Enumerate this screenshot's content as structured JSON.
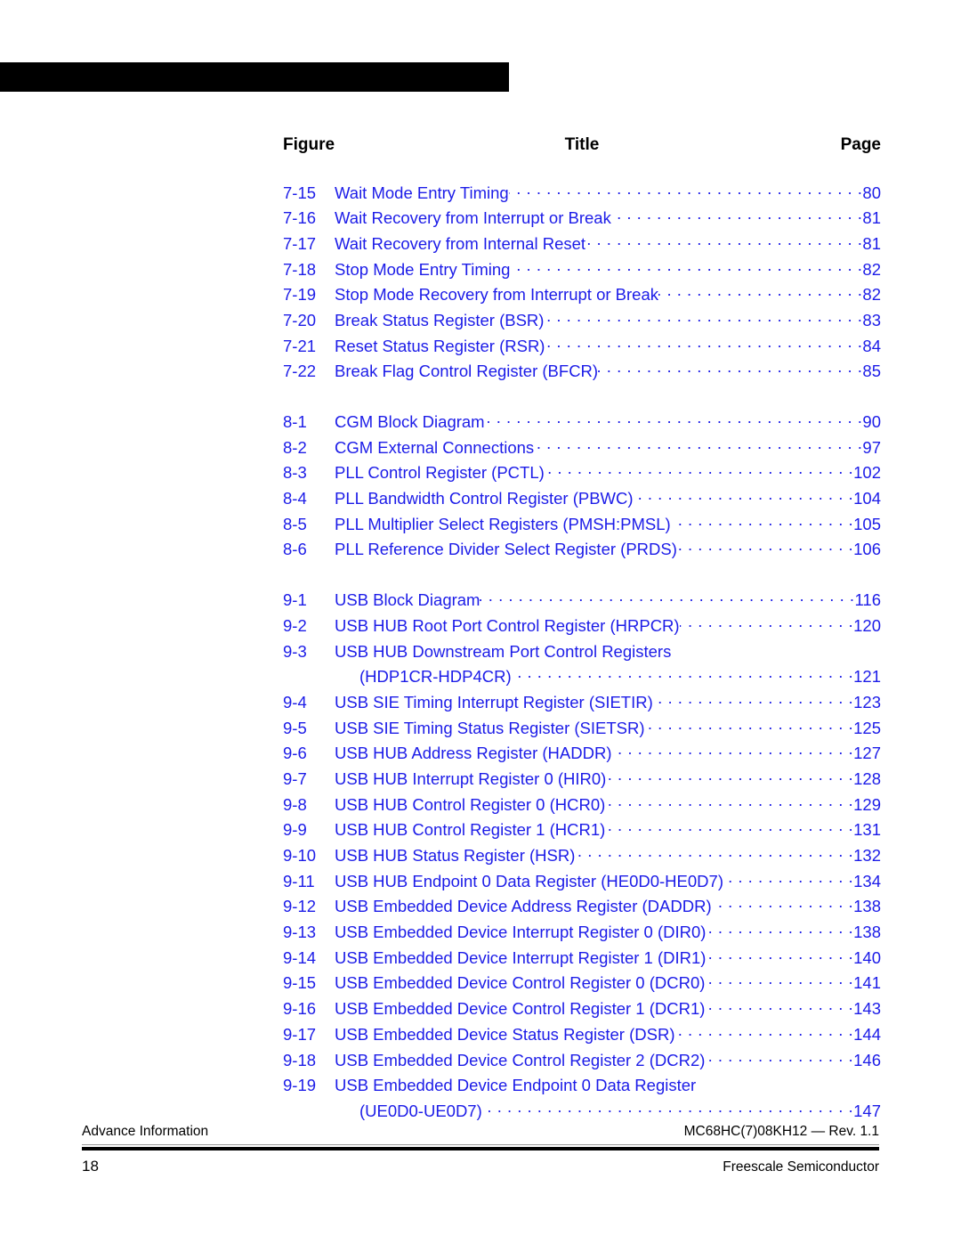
{
  "header": {
    "bar_color": "#000000"
  },
  "toc": {
    "columns": {
      "figure": "Figure",
      "title": "Title",
      "page": "Page"
    },
    "accent_color": "#1c1ce8",
    "groups": [
      {
        "chapter": "7",
        "rows": [
          {
            "number": "7-15",
            "title": "Wait Mode Entry Timing",
            "page": "80"
          },
          {
            "number": "7-16",
            "title": "Wait Recovery from Interrupt or Break",
            "page": "81"
          },
          {
            "number": "7-17",
            "title": "Wait Recovery from Internal Reset",
            "page": "81"
          },
          {
            "number": "7-18",
            "title": "Stop Mode Entry Timing",
            "page": "82"
          },
          {
            "number": "7-19",
            "title": "Stop Mode Recovery from Interrupt or Break",
            "page": "82"
          },
          {
            "number": "7-20",
            "title": "Break Status Register (BSR)",
            "page": "83"
          },
          {
            "number": "7-21",
            "title": "Reset Status Register (RSR)",
            "page": "84"
          },
          {
            "number": "7-22",
            "title": "Break Flag Control Register (BFCR)",
            "page": "85"
          }
        ]
      },
      {
        "chapter": "8",
        "rows": [
          {
            "number": "8-1",
            "title": "CGM Block Diagram",
            "page": "90"
          },
          {
            "number": "8-2",
            "title": "CGM External Connections",
            "page": "97"
          },
          {
            "number": "8-3",
            "title": "PLL Control Register (PCTL)",
            "page": "102"
          },
          {
            "number": "8-4",
            "title": "PLL Bandwidth Control Register (PBWC)",
            "page": "104"
          },
          {
            "number": "8-5",
            "title": "PLL Multiplier Select Registers (PMSH:PMSL)",
            "page": "105"
          },
          {
            "number": "8-6",
            "title": "PLL Reference Divider Select Register (PRDS)",
            "page": "106"
          }
        ]
      },
      {
        "chapter": "9",
        "rows": [
          {
            "number": "9-1",
            "title": "USB Block Diagram",
            "page": "116"
          },
          {
            "number": "9-2",
            "title": "USB HUB Root Port Control Register (HRPCR)",
            "page": "120"
          },
          {
            "number": "9-3",
            "title": "USB HUB Downstream Port Control Registers",
            "page": "",
            "wrapped": true
          },
          {
            "number": "",
            "title": "(HDP1CR-HDP4CR)",
            "page": "121",
            "continuation": true
          },
          {
            "number": "9-4",
            "title": "USB SIE Timing Interrupt Register (SIETIR)",
            "page": "123"
          },
          {
            "number": "9-5",
            "title": "USB SIE Timing Status Register (SIETSR)",
            "page": "125"
          },
          {
            "number": "9-6",
            "title": "USB HUB Address Register (HADDR)",
            "page": "127"
          },
          {
            "number": "9-7",
            "title": "USB HUB Interrupt Register 0 (HIR0)",
            "page": "128"
          },
          {
            "number": "9-8",
            "title": "USB HUB Control Register 0 (HCR0)",
            "page": "129"
          },
          {
            "number": "9-9",
            "title": "USB HUB Control Register 1 (HCR1)",
            "page": "131"
          },
          {
            "number": "9-10",
            "title": "USB HUB Status Register (HSR)",
            "page": "132"
          },
          {
            "number": "9-11",
            "title": "USB HUB Endpoint 0 Data Register (HE0D0-HE0D7)",
            "page": "134"
          },
          {
            "number": "9-12",
            "title": "USB Embedded Device Address Register (DADDR)",
            "page": "138"
          },
          {
            "number": "9-13",
            "title": "USB Embedded Device Interrupt Register 0 (DIR0)",
            "page": "138"
          },
          {
            "number": "9-14",
            "title": "USB Embedded Device Interrupt Register 1 (DIR1)",
            "page": "140"
          },
          {
            "number": "9-15",
            "title": "USB Embedded Device Control Register 0 (DCR0)",
            "page": "141"
          },
          {
            "number": "9-16",
            "title": "USB Embedded Device Control Register 1 (DCR1)",
            "page": "143"
          },
          {
            "number": "9-17",
            "title": "USB Embedded Device Status Register (DSR)",
            "page": "144"
          },
          {
            "number": "9-18",
            "title": "USB Embedded Device Control Register 2 (DCR2)",
            "page": "146"
          },
          {
            "number": "9-19",
            "title": "USB Embedded Device Endpoint 0 Data Register",
            "page": "",
            "wrapped": true
          },
          {
            "number": "",
            "title": "(UE0D0-UE0D7)",
            "page": "147",
            "continuation": true
          }
        ]
      }
    ]
  },
  "footer": {
    "doc_status": "Advance Information",
    "doc_id": "MC68HC(7)08KH12 — Rev. 1.1",
    "page_number": "18",
    "company": "Freescale Semiconductor"
  }
}
